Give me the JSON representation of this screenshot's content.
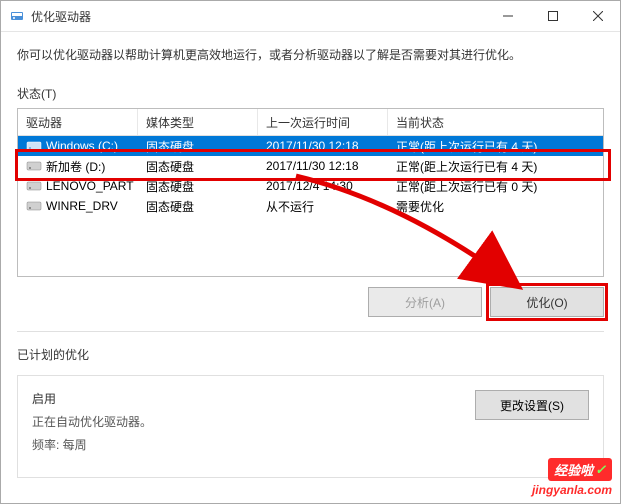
{
  "window": {
    "title": "优化驱动器"
  },
  "description": "你可以优化驱动器以帮助计算机更高效地运行，或者分析驱动器以了解是否需要对其进行优化。",
  "status_label": "状态(T)",
  "columns": {
    "drive": "驱动器",
    "media": "媒体类型",
    "last_run": "上一次运行时间",
    "current": "当前状态"
  },
  "rows": [
    {
      "name": "Windows (C:)",
      "media": "固态硬盘",
      "last": "2017/11/30 12:18",
      "status": "正常(距上次运行已有 4 天)"
    },
    {
      "name": "新加卷 (D:)",
      "media": "固态硬盘",
      "last": "2017/11/30 12:18",
      "status": "正常(距上次运行已有 4 天)"
    },
    {
      "name": "LENOVO_PART",
      "media": "固态硬盘",
      "last": "2017/12/4 14:30",
      "status": "正常(距上次运行已有 0 天)"
    },
    {
      "name": "WINRE_DRV",
      "media": "固态硬盘",
      "last": "从不运行",
      "status": "需要优化"
    }
  ],
  "buttons": {
    "analyze": "分析(A)",
    "optimize": "优化(O)"
  },
  "scheduled": {
    "label": "已计划的优化",
    "enabled": "启用",
    "desc": "正在自动优化驱动器。",
    "freq": "频率: 每周",
    "change": "更改设置(S)"
  },
  "watermark": {
    "brand": "经验啦",
    "url": "jingyanla.com"
  }
}
